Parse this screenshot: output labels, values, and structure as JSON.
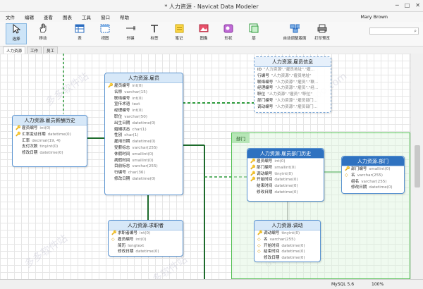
{
  "window": {
    "title": "* 人力资源 - Navicat Data Modeler",
    "minimize": "─",
    "maximize": "□",
    "close": "✕"
  },
  "menu": [
    "文件",
    "编辑",
    "查看",
    "图表",
    "工具",
    "窗口",
    "帮助"
  ],
  "user": "Mary Brown",
  "toolbar": [
    {
      "label": "选择",
      "icon": "pointer-icon"
    },
    {
      "label": "移动",
      "icon": "hand-icon"
    },
    {
      "label": "表",
      "icon": "table-icon"
    },
    {
      "label": "视图",
      "icon": "view-icon"
    },
    {
      "label": "外键",
      "icon": "foreign-key-icon"
    },
    {
      "label": "标签",
      "icon": "text-icon"
    },
    {
      "label": "笔记",
      "icon": "note-icon"
    },
    {
      "label": "图像",
      "icon": "image-icon"
    },
    {
      "label": "形状",
      "icon": "shape-icon"
    },
    {
      "label": "层",
      "icon": "layer-icon"
    },
    {
      "label": "自动调整版面",
      "icon": "auto-layout-icon"
    },
    {
      "label": "打印预览",
      "icon": "print-preview-icon"
    }
  ],
  "search_placeholder": "",
  "tabs": [
    "人力资源",
    "工作",
    "员工"
  ],
  "status": {
    "db": "MySQL 5.6",
    "zoom": "100%"
  },
  "layer_label": "部门",
  "watermarks": [
    "多多软件站",
    "ddooo.com",
    "多多软件站",
    "ddooo.com",
    "多多软件站"
  ],
  "tables": {
    "employee": {
      "title": "人力资源.雇员",
      "rows": [
        {
          "k": "🔑",
          "n": "雇员编号",
          "t": "int(0)"
        },
        {
          "k": "",
          "n": "名称",
          "t": "varchar(15)"
        },
        {
          "k": "",
          "n": "联络编号",
          "t": "int(0)"
        },
        {
          "k": "",
          "n": "宣传术语",
          "t": "text"
        },
        {
          "k": "",
          "n": "经理编号",
          "t": "int(0)"
        },
        {
          "k": "",
          "n": "职位",
          "t": "varchar(50)"
        },
        {
          "k": "",
          "n": "出生日期",
          "t": "datetime(0)"
        },
        {
          "k": "",
          "n": "婚姻状态",
          "t": "char(1)"
        },
        {
          "k": "",
          "n": "性别",
          "t": "char(1)"
        },
        {
          "k": "",
          "n": "雇用日期",
          "t": "datetime(0)"
        },
        {
          "k": "",
          "n": "受薪标志",
          "t": "varchar(255)"
        },
        {
          "k": "",
          "n": "休假时间",
          "t": "smallint(0)"
        },
        {
          "k": "",
          "n": "病假时间",
          "t": "smallint(0)"
        },
        {
          "k": "",
          "n": "目前标志",
          "t": "varchar(255)"
        },
        {
          "k": "",
          "n": "行编号",
          "t": "char(36)"
        },
        {
          "k": "",
          "n": "修改日期",
          "t": "datetime(0)"
        }
      ]
    },
    "payhist": {
      "title": "人力资源.雇员薪酬历史",
      "rows": [
        {
          "k": "🔑",
          "n": "雇员编号",
          "t": "int(0)"
        },
        {
          "k": "🔑",
          "n": "汇率变动日期",
          "t": "datetime(0)"
        },
        {
          "k": "",
          "n": "汇率",
          "t": "decimal(19, 4)"
        },
        {
          "k": "",
          "n": "支付次数",
          "t": "tinyint(0)"
        },
        {
          "k": "",
          "n": "修改日期",
          "t": "datetime(0)"
        }
      ]
    },
    "empinfo": {
      "title": "人力资源.雇员信息",
      "rows": [
        {
          "k": "",
          "n": "ID",
          "t": "\"人力资源\".\"雇员地址\".\"雇..."
        },
        {
          "k": "",
          "n": "行编号",
          "t": "\"人力资源\".\"雇员地址\""
        },
        {
          "k": "",
          "n": "联络编号",
          "t": "\"人力资源\".\"雇员\".\"联..."
        },
        {
          "k": "",
          "n": "经理编号",
          "t": "\"人力资源\".\"雇员\".\"经..."
        },
        {
          "k": "",
          "n": "职位",
          "t": "\"人力资源\".\"雇员\".\"职位\""
        },
        {
          "k": "",
          "n": "部门编号",
          "t": "\"人力资源\".\"雇员部门..."
        },
        {
          "k": "",
          "n": "调动编号",
          "t": "\"人力资源\".\"雇员部门..."
        }
      ]
    },
    "depthist": {
      "title": "人力资源.雇员部门历史",
      "rows": [
        {
          "k": "🔑",
          "n": "雇员编号",
          "t": "int(0)"
        },
        {
          "k": "🔑",
          "n": "部门编号",
          "t": "smallint(0)"
        },
        {
          "k": "🔑",
          "n": "调动编号",
          "t": "tinyint(0)"
        },
        {
          "k": "🔑",
          "n": "开始时间",
          "t": "datetime(0)"
        },
        {
          "k": "",
          "n": "结束时间",
          "t": "datetime(0)"
        },
        {
          "k": "",
          "n": "修改日期",
          "t": "datetime(0)"
        }
      ]
    },
    "dept": {
      "title": "人力资源.部门",
      "rows": [
        {
          "k": "🔑",
          "n": "部门编号",
          "t": "smallint(0)"
        },
        {
          "k": "◇",
          "n": "名",
          "t": "varchar(255)"
        },
        {
          "k": "",
          "n": "组名",
          "t": "varchar(255)"
        },
        {
          "k": "",
          "n": "修改日期",
          "t": "datetime(0)"
        }
      ]
    },
    "candidate": {
      "title": "人力资源.求职者",
      "rows": [
        {
          "k": "🔑",
          "n": "求职者编号",
          "t": "int(0)"
        },
        {
          "k": "◇",
          "n": "雇员编号",
          "t": "int(0)"
        },
        {
          "k": "",
          "n": "简历",
          "t": "longtext"
        },
        {
          "k": "",
          "n": "修改日期",
          "t": "datetime(0)"
        }
      ]
    },
    "transfer": {
      "title": "人力资源.调动",
      "rows": [
        {
          "k": "🔑",
          "n": "调动编号",
          "t": "tinyint(0)"
        },
        {
          "k": "◇",
          "n": "名",
          "t": "varchar(255)"
        },
        {
          "k": "◇",
          "n": "开始时间",
          "t": "datetime(0)"
        },
        {
          "k": "◇",
          "n": "结束时间",
          "t": "datetime(0)"
        },
        {
          "k": "",
          "n": "修改日期",
          "t": "datetime(0)"
        }
      ]
    }
  }
}
